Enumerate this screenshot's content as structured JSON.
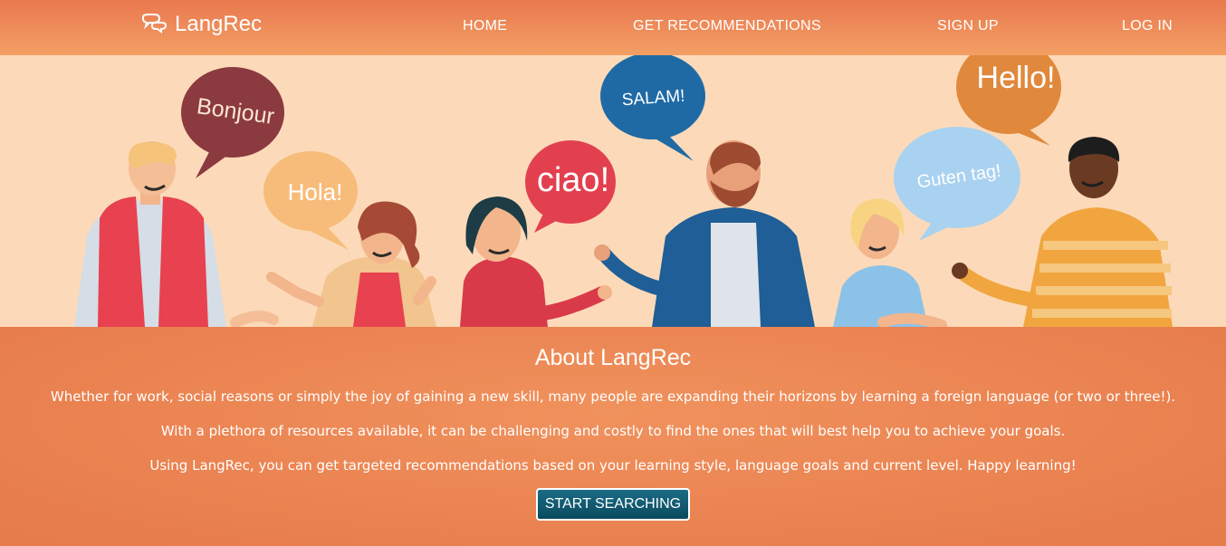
{
  "nav": {
    "brand": "LangRec",
    "links": [
      "HOME",
      "GET RECOMMENDATIONS",
      "SIGN UP",
      "LOG IN"
    ]
  },
  "hero": {
    "bubbles": [
      "Bonjour",
      "Hola!",
      "ciao!",
      "SALAM!",
      "Guten tag!",
      "Hello!"
    ]
  },
  "about": {
    "title": "About LangRec",
    "paragraphs": [
      "Whether for work, social reasons or simply the joy of gaining a new skill, many people are expanding their horizons by learning a foreign language (or two or three!).",
      "With a plethora of resources available, it can be challenging and costly to find the ones that will best help you to achieve your goals.",
      "Using LangRec, you can get targeted recommendations based on your learning style, language goals and current level. Happy learning!"
    ],
    "cta": "START SEARCHING"
  },
  "colors": {
    "nav": "#ee8a58",
    "hero_bg": "#fcdab9",
    "about_bg": "#ec8a55",
    "button": "#0b4a5e"
  }
}
